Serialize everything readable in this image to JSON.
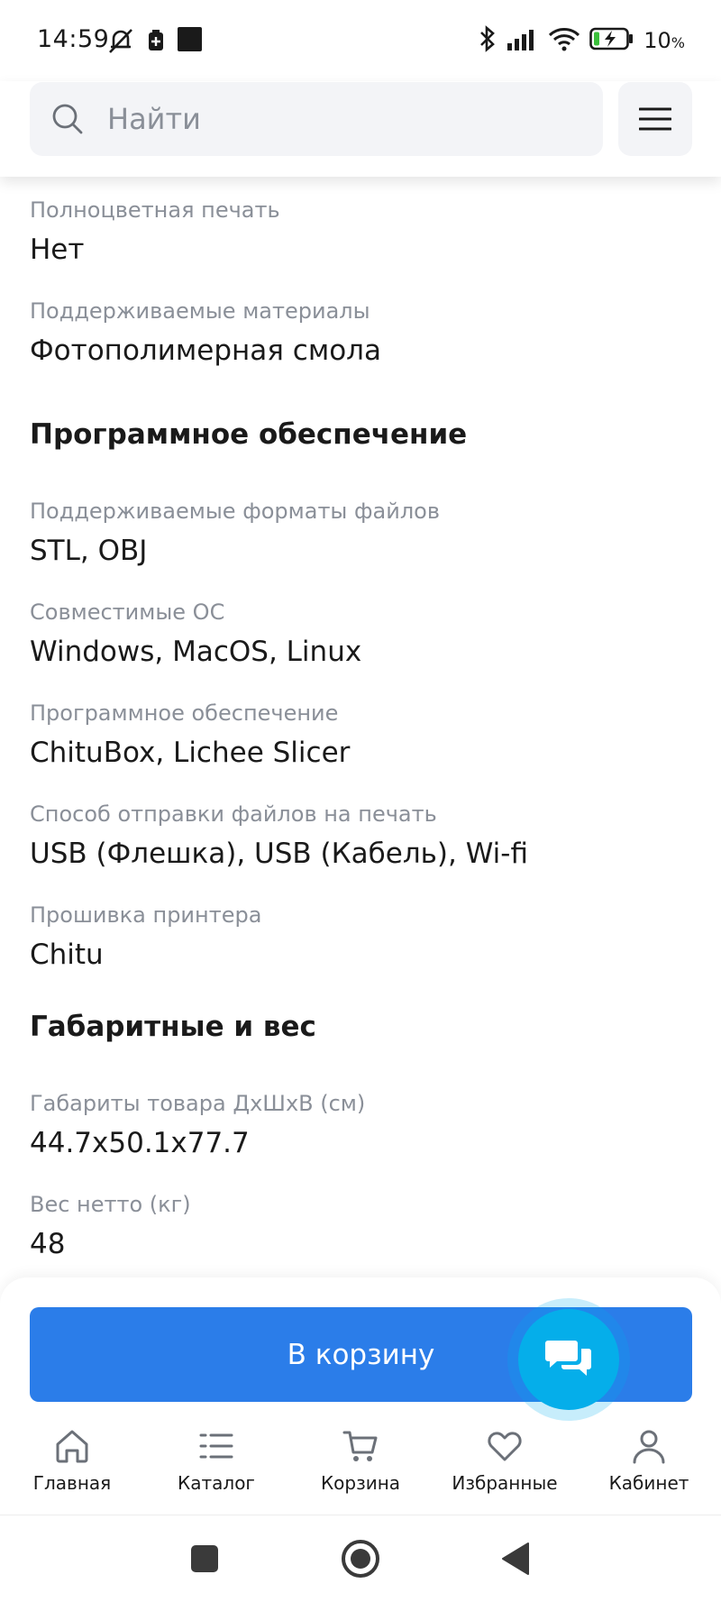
{
  "status_bar": {
    "time": "14:59",
    "battery": "10",
    "battery_unit": "%"
  },
  "search": {
    "placeholder": "Найти"
  },
  "icons": {
    "search": "search-icon",
    "menu": "hamburger-menu-icon",
    "chat": "chat-bubbles-icon",
    "home": "home-icon",
    "catalog": "list-icon",
    "cart": "cart-icon",
    "favorites": "heart-icon",
    "profile": "user-icon"
  },
  "specs": {
    "color_print": {
      "label": "Полноцветная печать",
      "value": "Нет"
    },
    "materials": {
      "label": "Поддерживаемые материалы",
      "value": "Фотополимерная смола"
    },
    "software_section": "Программное обеспечение",
    "file_formats": {
      "label": "Поддерживаемые форматы файлов",
      "value": "STL, OBJ"
    },
    "os": {
      "label": "Совместимые ОС",
      "value": "Windows, MacOS, Linux"
    },
    "software": {
      "label": "Программное обеспечение",
      "value": "ChituBox, Lichee Slicer"
    },
    "transfer": {
      "label": "Способ отправки файлов на печать",
      "value": "USB (Флешка), USB (Кабель), Wi-fi"
    },
    "firmware": {
      "label": "Прошивка принтера",
      "value": "Chitu"
    },
    "dimensions_section": "Габаритные и вес",
    "dimensions": {
      "label": "Габариты товара ДхШхВ (см)",
      "value": "44.7x50.1x77.7"
    },
    "weight": {
      "label": "Вес нетто (кг)",
      "value": "48"
    }
  },
  "actions": {
    "add_to_cart": "В корзину"
  },
  "bottom_nav": {
    "home": "Главная",
    "catalog": "Каталог",
    "cart": "Корзина",
    "favorites": "Избранные",
    "profile": "Кабинет"
  },
  "colors": {
    "accent": "#2b7de9",
    "chat": "#05aeea",
    "label_gray": "#8a8f98",
    "text": "#1a1a1a"
  }
}
